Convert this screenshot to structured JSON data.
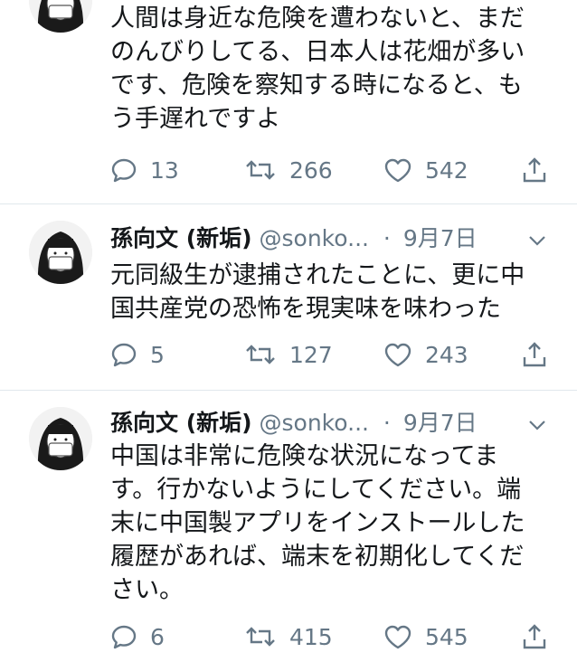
{
  "tweets": [
    {
      "body": "人間は身近な危険を遭わないと、まだ\nのんびりしてる、日本人は花畑が多い\nです、危険を察知する時になると、も\nう手遅れですよ",
      "reply_count": "13",
      "retweet_count": "266",
      "like_count": "542"
    },
    {
      "name": "孫向文 (新垢)",
      "handle": "@sonko...",
      "dot": "·",
      "date": "9月7日",
      "body": "元同級生が逮捕されたことに、更に中\n国共産党の恐怖を現実味を味わった",
      "reply_count": "5",
      "retweet_count": "127",
      "like_count": "243"
    },
    {
      "name": "孫向文 (新垢)",
      "handle": "@sonko...",
      "dot": "·",
      "date": "9月7日",
      "body": "中国は非常に危険な状況になってま\nす。行かないようにしてください。端\n末に中国製アプリをインストールした\n履歴があれば、端末を初期化してくだ\nさい。",
      "reply_count": "6",
      "retweet_count": "415",
      "like_count": "545"
    }
  ],
  "colors": {
    "text": "#14171a",
    "secondary": "#657786",
    "divider": "#e1e8ed"
  },
  "icons": [
    "reply-icon",
    "retweet-icon",
    "like-icon",
    "share-icon",
    "chevron-down-icon"
  ]
}
